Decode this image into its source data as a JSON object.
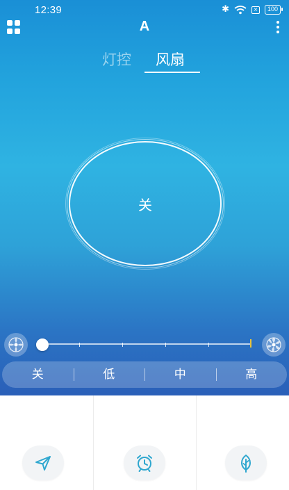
{
  "status_bar": {
    "time": "12:39",
    "battery": "100",
    "icons": [
      "bluetooth-icon",
      "wifi-icon",
      "sim-icon",
      "battery-icon"
    ]
  },
  "header": {
    "title": "A",
    "left_icon": "grid-menu-icon",
    "right_icon": "more-vertical-icon"
  },
  "tabs": [
    {
      "label": "灯控",
      "active": false
    },
    {
      "label": "风扇",
      "active": true
    }
  ],
  "power": {
    "label": "关"
  },
  "speed_slider": {
    "value": 0,
    "min_icon": "fan-slow-icon",
    "max_icon": "fan-fast-icon"
  },
  "speed_options": [
    {
      "label": "关"
    },
    {
      "label": "低"
    },
    {
      "label": "中"
    },
    {
      "label": "高"
    }
  ],
  "bottom_actions": [
    {
      "icon": "send-icon"
    },
    {
      "icon": "alarm-clock-icon"
    },
    {
      "icon": "leaf-icon"
    }
  ],
  "colors": {
    "accent": "#2fa7cf",
    "gradient_top": "#1a8fd6",
    "gradient_bottom": "#2a5fb8",
    "slider_end_marker": "#e8c33a"
  }
}
